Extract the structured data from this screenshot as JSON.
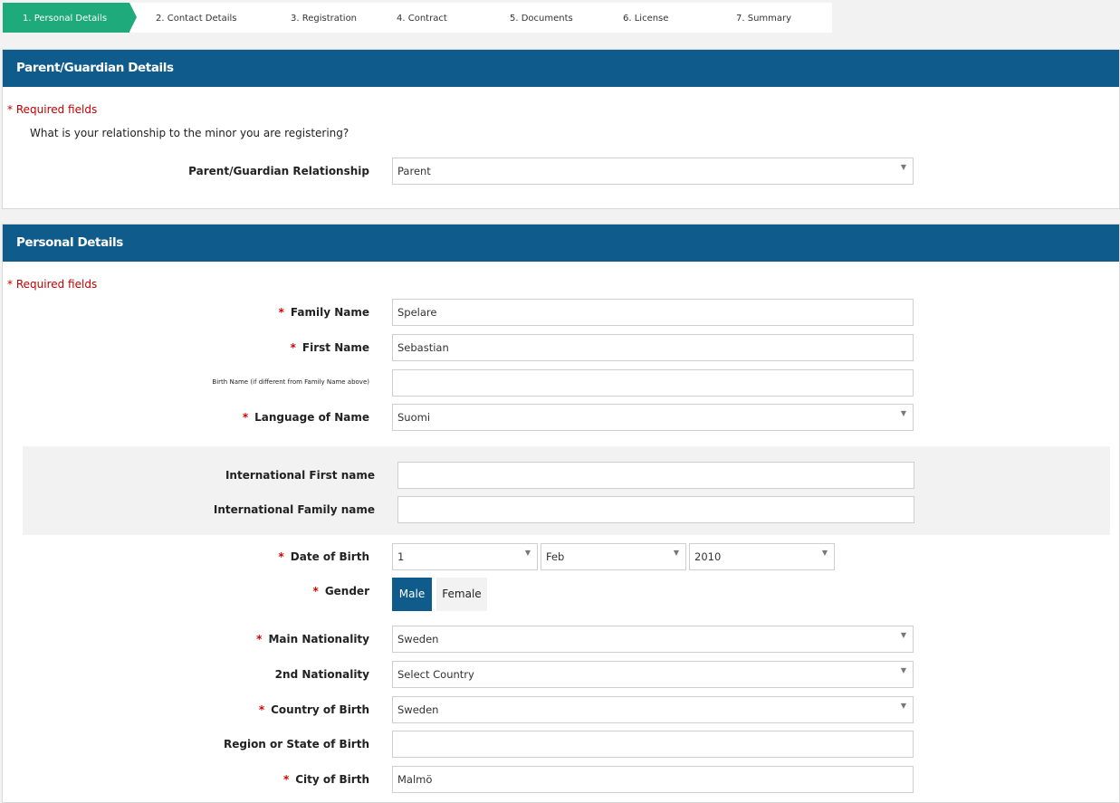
{
  "stepper": {
    "steps": [
      {
        "label": "1. Personal Details",
        "active": true
      },
      {
        "label": "2. Contact Details"
      },
      {
        "label": "3. Registration"
      },
      {
        "label": "4. Contract"
      },
      {
        "label": "5. Documents"
      },
      {
        "label": "6. License"
      },
      {
        "label": "7. Summary"
      }
    ]
  },
  "guardian": {
    "title": "Parent/Guardian Details",
    "required_note": "Required fields",
    "question": "What is your relationship to the minor you are registering?",
    "relationship_label": "Parent/Guardian Relationship",
    "relationship_value": "Parent"
  },
  "personal": {
    "title": "Personal Details",
    "required_note": "Required fields",
    "family_name": {
      "label": "Family Name",
      "value": "Spelare"
    },
    "first_name": {
      "label": "First Name",
      "value": "Sebastian"
    },
    "birth_name": {
      "label": "Birth Name (if different from Family Name above)",
      "value": ""
    },
    "language": {
      "label": "Language of Name",
      "value": "Suomi"
    },
    "intl_first": {
      "label": "International First name",
      "value": ""
    },
    "intl_family": {
      "label": "International Family name",
      "value": ""
    },
    "dob": {
      "label": "Date of Birth",
      "day": "1",
      "month": "Feb",
      "year": "2010"
    },
    "gender": {
      "label": "Gender",
      "male": "Male",
      "female": "Female",
      "selected": "Male"
    },
    "main_nationality": {
      "label": "Main Nationality",
      "value": "Sweden"
    },
    "second_nationality": {
      "label": "2nd Nationality",
      "value": "Select Country"
    },
    "country_of_birth": {
      "label": "Country of Birth",
      "value": "Sweden"
    },
    "region_of_birth": {
      "label": "Region or State of Birth",
      "value": ""
    },
    "city_of_birth": {
      "label": "City of Birth",
      "value": "Malmö"
    }
  },
  "colors": {
    "accent": "#1eaa7b",
    "header": "#0f5b8c",
    "required": "#d40000"
  },
  "icons": {
    "select_arrow": "chevron-down-icon",
    "required_star": "asterisk"
  }
}
